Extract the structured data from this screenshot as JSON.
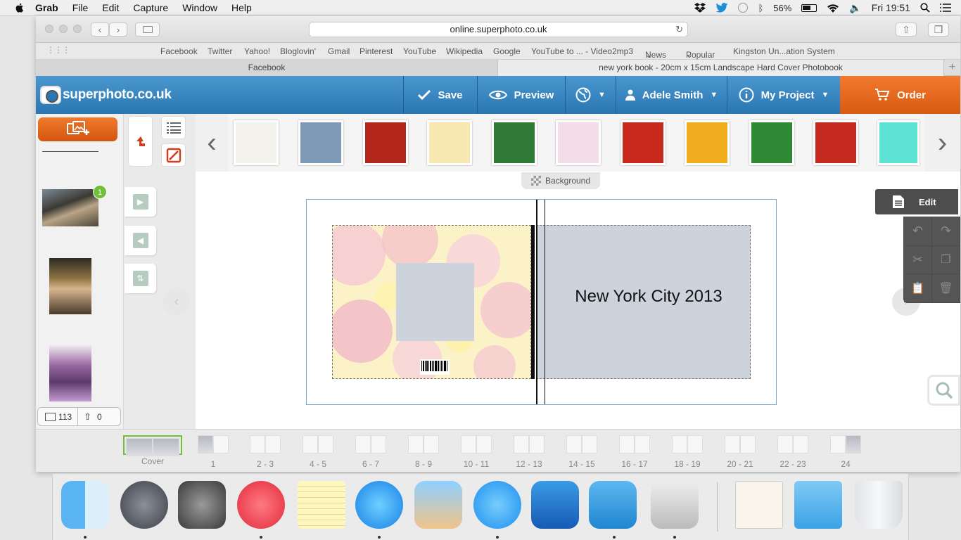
{
  "menubar": {
    "items": [
      "Grab",
      "File",
      "Edit",
      "Capture",
      "Window",
      "Help"
    ],
    "battery": "56%",
    "clock": "Fri 19:51"
  },
  "browser": {
    "url": "online.superphoto.co.uk",
    "bookmarks": [
      "Facebook",
      "Twitter",
      "Yahoo!",
      "Bloglovin'",
      "Gmail",
      "Pinterest",
      "YouTube",
      "Wikipedia",
      "Google",
      "YouTube to ... - Video2mp3",
      "News",
      "Popular",
      "Kingston Un...ation System"
    ],
    "tabs": [
      "Facebook",
      "new york book - 20cm x 15cm Landscape Hard Cover Photobook"
    ]
  },
  "header": {
    "logo": "superphoto.co.uk",
    "save": "Save",
    "preview": "Preview",
    "user": "Adele Smith",
    "project": "My Project",
    "order": "Order"
  },
  "sidebar": {
    "badge": "1",
    "photo_count": "113",
    "upload_count": "0"
  },
  "backgrounds": {
    "label": "Background",
    "swatches": [
      "#f4f2ec",
      "#7f9ab6",
      "#b3271c",
      "#f7e7b0",
      "#2e7a36",
      "#f1dce8",
      "#c9281c",
      "#f0ac1c",
      "#2e8a34",
      "#c42a1e",
      "#5ee2d3"
    ]
  },
  "book": {
    "title": "New York City 2013"
  },
  "edit_panel": {
    "label": "Edit"
  },
  "pages": [
    "Cover",
    "1",
    "2 - 3",
    "4 - 5",
    "6 - 7",
    "8 - 9",
    "10 - 11",
    "12 - 13",
    "14 - 15",
    "16 - 17",
    "18 - 19",
    "20 - 21",
    "22 - 23",
    "24"
  ]
}
